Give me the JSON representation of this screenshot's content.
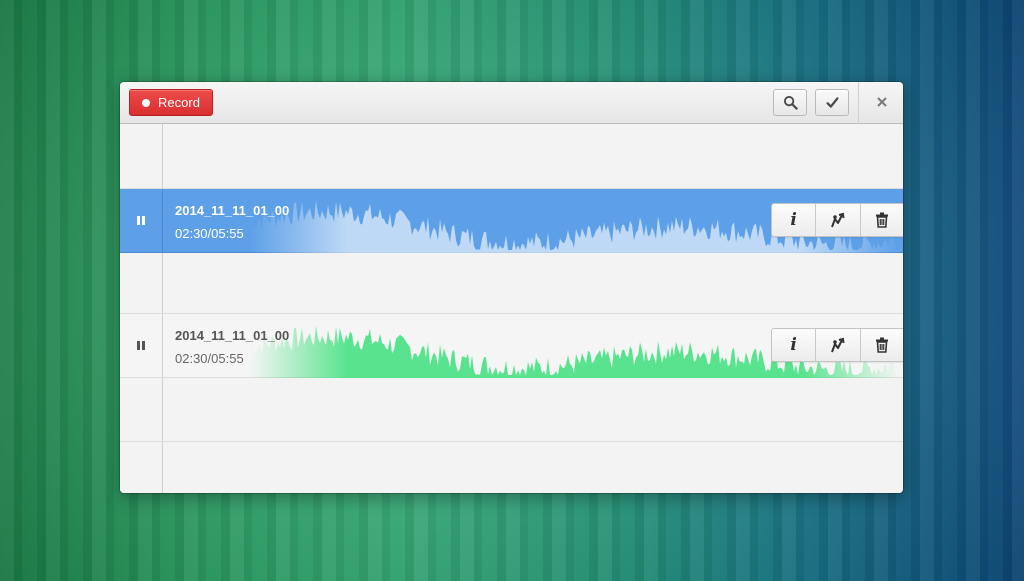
{
  "headerbar": {
    "record_label": "Record",
    "search_icon": "search-icon",
    "done_icon": "checkmark-icon",
    "close_icon": "close-icon"
  },
  "recordings": [
    {
      "name": "2014_11_11_01_00",
      "time": "02:30/05:55",
      "state": "playing",
      "selected": true,
      "actions": [
        "info-icon",
        "share-icon",
        "trash-icon"
      ]
    },
    {
      "name": "2014_11_11_01_00",
      "time": "02:30/05:55",
      "state": "playing",
      "selected": false,
      "actions": [
        "info-icon",
        "share-icon",
        "trash-icon"
      ]
    }
  ],
  "colors": {
    "record": "#e03a3a",
    "selected_row": "#5ea0e8",
    "selected_wave": "#ffffff",
    "normal_wave": "#3ee07c"
  }
}
